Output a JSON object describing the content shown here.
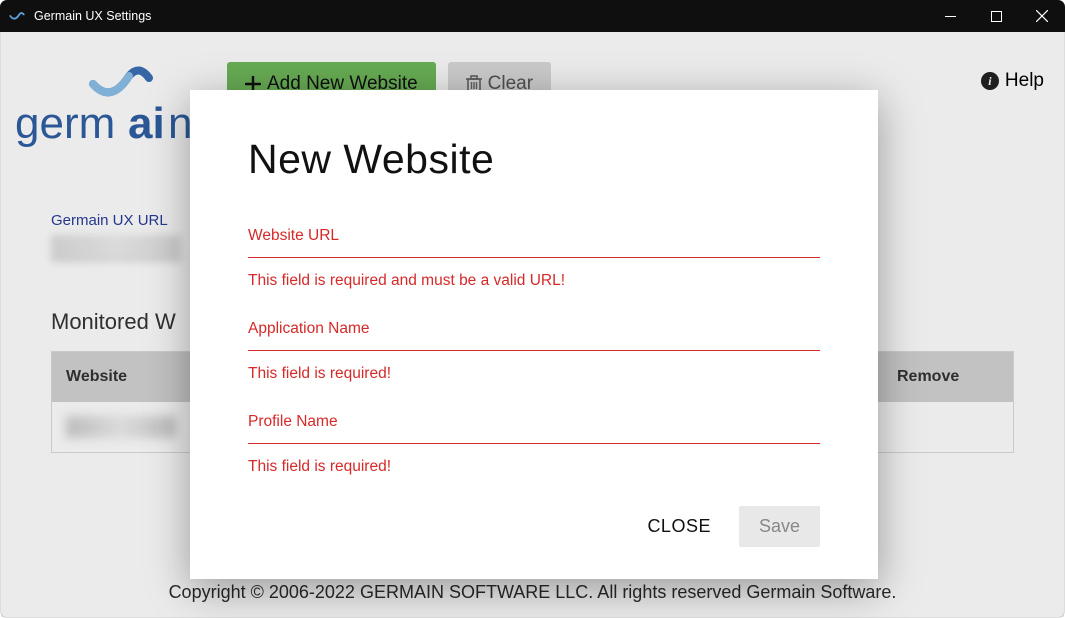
{
  "window": {
    "title": "Germain UX Settings"
  },
  "logo": {
    "brand_part1": "germ",
    "brand_part2": "ai",
    "brand_part3": "n"
  },
  "toolbar": {
    "add_label": "Add New Website",
    "clear_label": "Clear",
    "help_label": "Help"
  },
  "url_section": {
    "label": "Germain UX URL"
  },
  "monitored": {
    "heading_partial": "Monitored W",
    "columns": {
      "website": "Website",
      "remove": "Remove"
    }
  },
  "modal": {
    "title": "New Website",
    "fields": {
      "website_url": {
        "label": "Website URL",
        "error": "This field is required and must be a valid URL!"
      },
      "application_name": {
        "label": "Application Name",
        "error": "This field is required!"
      },
      "profile_name": {
        "label": "Profile Name",
        "error": "This field is required!"
      }
    },
    "close_label": "CLOSE",
    "save_label": "Save"
  },
  "footer": {
    "text": "Copyright © 2006-2022 GERMAIN SOFTWARE LLC. All rights reserved Germain Software."
  }
}
